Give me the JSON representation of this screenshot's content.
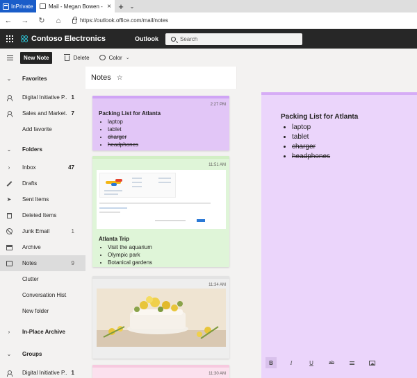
{
  "browser": {
    "inprivate_label": "InPrivate",
    "tab_title": "Mail - Megan Bowen - O",
    "tab_close": "×",
    "new_tab": "+",
    "tab_dropdown": "⌄",
    "url": "https://outlook.office.com/mail/notes"
  },
  "suite": {
    "brand": "Contoso Electronics",
    "app": "Outlook",
    "search_placeholder": "Search"
  },
  "commands": {
    "new_note": "New Note",
    "delete": "Delete",
    "color": "Color"
  },
  "nav": {
    "favorites_header": "Favorites",
    "favorites": [
      {
        "label": "Digital Initiative P...",
        "count": "1"
      },
      {
        "label": "Sales and Market...",
        "count": "7"
      }
    ],
    "add_favorite": "Add favorite",
    "folders_header": "Folders",
    "folders": [
      {
        "label": "Inbox",
        "count": "47"
      },
      {
        "label": "Drafts",
        "count": ""
      },
      {
        "label": "Sent Items",
        "count": ""
      },
      {
        "label": "Deleted Items",
        "count": ""
      },
      {
        "label": "Junk Email",
        "count": "1"
      },
      {
        "label": "Archive",
        "count": ""
      },
      {
        "label": "Notes",
        "count": "9"
      },
      {
        "label": "Clutter",
        "count": ""
      },
      {
        "label": "Conversation Hist...",
        "count": ""
      }
    ],
    "new_folder": "New folder",
    "inplace_archive": "In-Place Archive -...",
    "groups_header": "Groups",
    "groups": [
      {
        "label": "Digital Initiative P...",
        "count": "1"
      }
    ]
  },
  "notes_list": {
    "title": "Notes",
    "notes": [
      {
        "time": "2:27 PM",
        "title": "Packing List for Atlanta",
        "items": [
          "laptop",
          "tablet",
          "charger",
          "headphones"
        ]
      },
      {
        "time": "11:51 AM",
        "title": "Atlanta Trip",
        "items": [
          "Visit the aquarium",
          "Olympic park",
          "Botanical gardens"
        ]
      },
      {
        "time": "11:34 AM"
      },
      {
        "time": "11:30 AM"
      }
    ]
  },
  "reading_pane": {
    "title": "Packing List for Atlanta",
    "items": [
      "laptop",
      "tablet",
      "charger",
      "headphones"
    ],
    "toolbar": {
      "bold": "B",
      "italic": "I",
      "underline": "U",
      "strike": "ab"
    }
  }
}
